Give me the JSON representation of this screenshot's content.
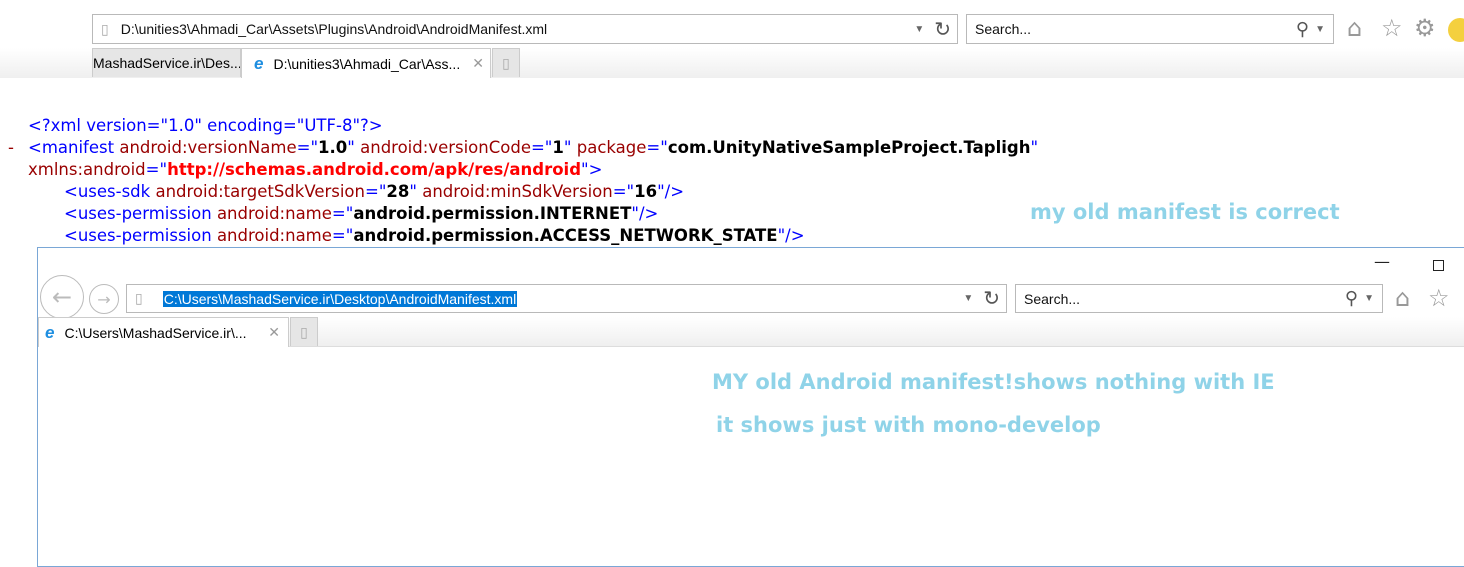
{
  "top_window": {
    "address": "D:\\unities3\\Ahmadi_Car\\Assets\\Plugins\\Android\\AndroidManifest.xml",
    "search_placeholder": "Search...",
    "tabs": [
      {
        "label": "MashadService.ir\\Des...",
        "active": false
      },
      {
        "label": "D:\\unities3\\Ahmadi_Car\\Ass...",
        "active": true
      }
    ],
    "toolbar_icons": [
      "home-icon",
      "star-icon",
      "gear-icon",
      "smiley-icon"
    ]
  },
  "xml": {
    "decl": "<?xml version=\"1.0\" encoding=\"UTF-8\"?>",
    "collapse": "-",
    "manifest": {
      "tag": "<manifest",
      "a1": "android:versionName",
      "v1": "1.0",
      "a2": "android:versionCode",
      "v2": "1",
      "a3": "package",
      "v3": "com.UnityNativeSampleProject.Tapligh",
      "a4": "xmlns:android",
      "v4": "http://schemas.android.com/apk/res/android"
    },
    "uses_sdk": {
      "tag": "<uses-sdk",
      "a1": "android:targetSdkVersion",
      "v1": "28",
      "a2": "android:minSdkVersion",
      "v2": "16"
    },
    "perm1": {
      "tag": "<uses-permission",
      "a1": "android:name",
      "v1": "android.permission.INTERNET"
    },
    "perm2": {
      "tag": "<uses-permission",
      "a1": "android:name",
      "v1": "android.permission.ACCESS_NETWORK_STATE"
    }
  },
  "notes": {
    "correct": "my old manifest is correct",
    "nothing": "MY old Android manifest!shows nothing with IE",
    "mono": "it shows just with mono-develop"
  },
  "bottom_window": {
    "address": "C:\\Users\\MashadService.ir\\Desktop\\AndroidManifest.xml",
    "search_placeholder": "Search...",
    "tab": "C:\\Users\\MashadService.ir\\..."
  },
  "colors": {
    "selection": "#0078d7",
    "note": "#8fd3e8",
    "tag": "#0000ff",
    "attr": "#990000"
  }
}
